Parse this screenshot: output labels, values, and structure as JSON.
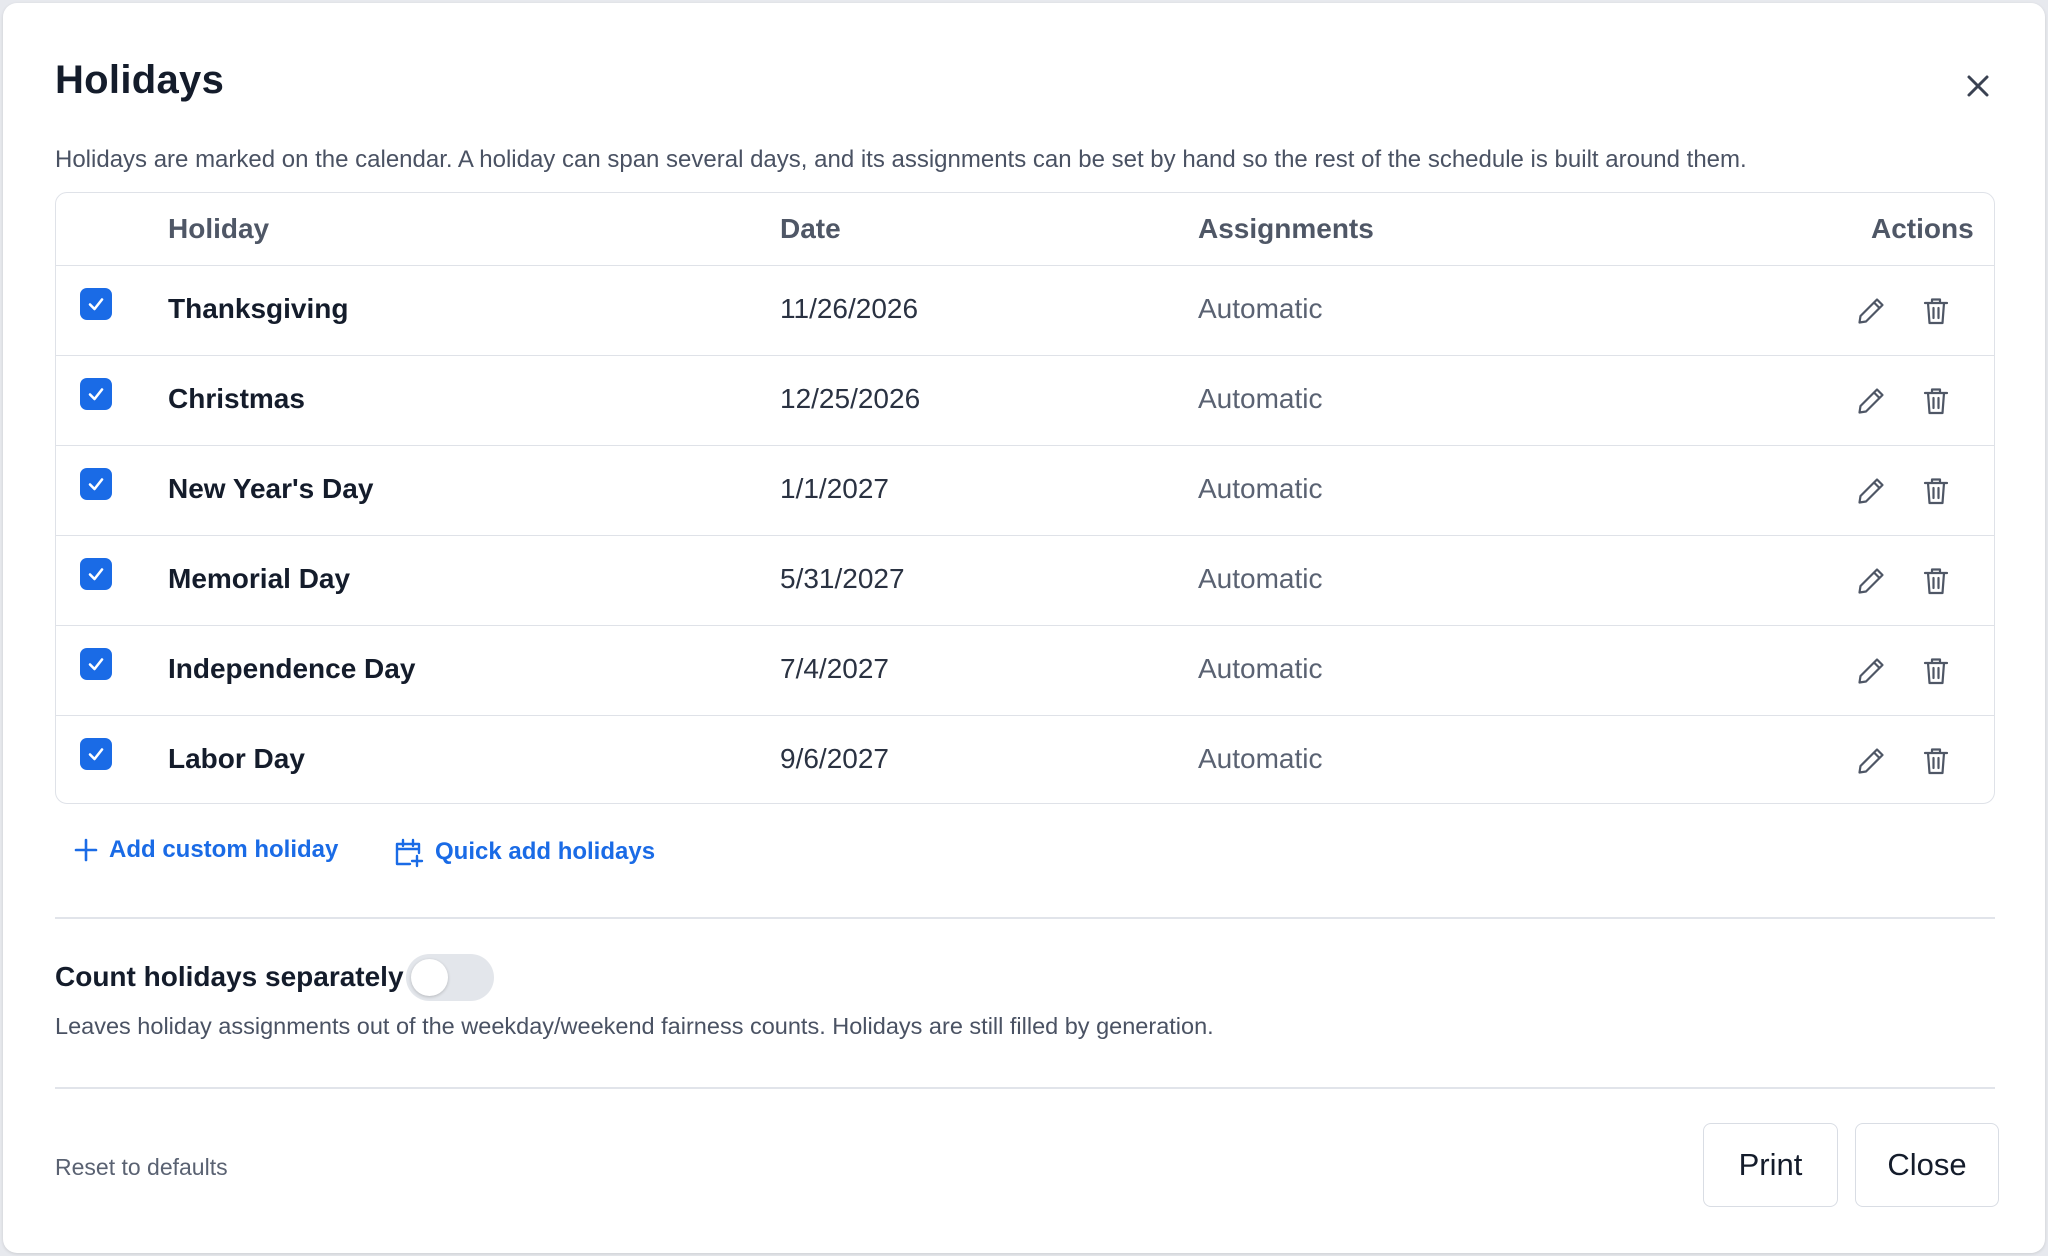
{
  "dialog": {
    "title": "Holidays",
    "description": "Holidays are marked on the calendar. A holiday can span several days, and its assignments can be set by hand so the rest of the schedule is built around them."
  },
  "table": {
    "headers": {
      "holiday": "Holiday",
      "date": "Date",
      "assignments": "Assignments",
      "actions": "Actions"
    },
    "rows": [
      {
        "name": "Thanksgiving",
        "date": "11/26/2026",
        "assignments": "Automatic",
        "checked": true
      },
      {
        "name": "Christmas",
        "date": "12/25/2026",
        "assignments": "Automatic",
        "checked": true
      },
      {
        "name": "New Year's Day",
        "date": "1/1/2027",
        "assignments": "Automatic",
        "checked": true
      },
      {
        "name": "Memorial Day",
        "date": "5/31/2027",
        "assignments": "Automatic",
        "checked": true
      },
      {
        "name": "Independence Day",
        "date": "7/4/2027",
        "assignments": "Automatic",
        "checked": true
      },
      {
        "name": "Labor Day",
        "date": "9/6/2027",
        "assignments": "Automatic",
        "checked": true
      }
    ]
  },
  "actions": {
    "add_custom": "Add custom holiday",
    "quick_add": "Quick add holidays"
  },
  "settings": {
    "count_separately_label": "Count holidays separately",
    "count_separately_enabled": false,
    "count_separately_help": "Leaves holiday assignments out of the weekday/weekend fairness counts. Holidays are still filled by generation."
  },
  "footer": {
    "reset": "Reset to defaults",
    "print": "Print",
    "close": "Close"
  },
  "icons": {
    "close": "close-icon",
    "check": "checkmark-icon",
    "edit": "pencil-icon",
    "delete": "trash-icon",
    "add": "plus-icon",
    "calendar": "calendar-plus-icon"
  },
  "colors": {
    "accent": "#1a6be6",
    "text": "#141c2b",
    "muted": "#5a6272",
    "border": "#dfe2e8"
  }
}
